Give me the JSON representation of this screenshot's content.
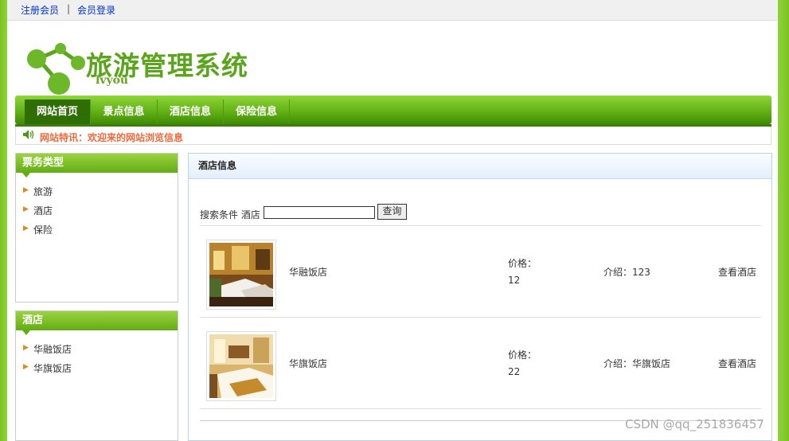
{
  "topbar": {
    "register": "注册会员",
    "separator": "|",
    "login": "会员登录"
  },
  "logo": {
    "title": "旅游管理系统",
    "subtitle": "lvyou"
  },
  "nav": [
    "网站首页",
    "景点信息",
    "酒店信息",
    "保险信息"
  ],
  "notice": "网站特讯：欢迎来的网站浏览信息",
  "sidebar1": {
    "title": "票务类型",
    "items": [
      "旅游",
      "酒店",
      "保险"
    ]
  },
  "sidebar2": {
    "title": "酒店",
    "items": [
      "华融饭店",
      "华旗饭店"
    ]
  },
  "main": {
    "title": "酒店信息",
    "search_label": "搜索条件 酒店",
    "search_value": "",
    "search_button": "查询",
    "hotels": [
      {
        "name": "华融饭店",
        "price_label": "价格：",
        "price": "12",
        "intro": "介绍：123",
        "view": "查看酒店"
      },
      {
        "name": "华旗饭店",
        "price_label": "价格：",
        "price": "22",
        "intro": "介绍：华旗饭店",
        "view": "查看酒店"
      }
    ]
  },
  "watermark": "CSDN @qq_251836457",
  "colors": {
    "accent": "#5fae12",
    "notice": "#ee6a3a",
    "link": "#0033cc"
  }
}
